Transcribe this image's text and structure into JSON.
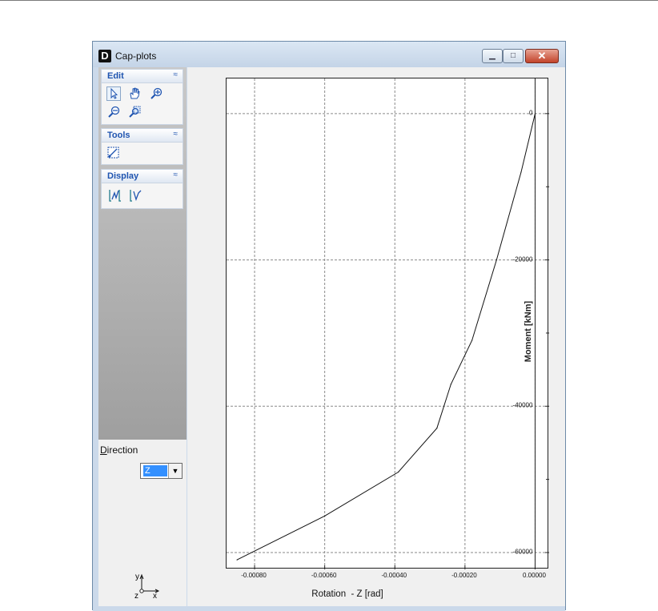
{
  "window": {
    "app_icon_letter": "D",
    "title": "Cap-plots",
    "minimize_glyph": "▁",
    "maximize_glyph": "□",
    "close_glyph": "✕"
  },
  "sidebar": {
    "groups": [
      {
        "title": "Edit",
        "collapse_glyph": "≈",
        "tools": [
          "select-arrow-icon",
          "hand-pan-icon",
          "zoom-in-icon",
          "zoom-out-icon",
          "zoom-window-icon"
        ]
      },
      {
        "title": "Tools",
        "collapse_glyph": "≈",
        "tools": [
          "measure-icon"
        ]
      },
      {
        "title": "Display",
        "collapse_glyph": "≈",
        "tools": [
          "display-curves-icon",
          "display-pointer-icon"
        ]
      }
    ],
    "direction": {
      "label_accel": "D",
      "label_rest": "irection",
      "selected": "Z",
      "arrow": "▼"
    },
    "triad": {
      "y": "y",
      "z": "z",
      "x": "x"
    }
  },
  "accent_color": "#1f54b0",
  "chart_data": {
    "type": "line",
    "title": "",
    "xlabel": "Rotation  - Z [rad]",
    "ylabel": "Moment [kNm]",
    "xlim": [
      -0.00088,
      4e-05
    ],
    "ylim": [
      -62300,
      4800
    ],
    "x_ticks": [
      -0.0008,
      -0.0006,
      -0.0004,
      -0.0002,
      0.0
    ],
    "x_tick_labels": [
      "-0.00080",
      "-0.00060",
      "-0.00040",
      "-0.00020",
      "0.00000"
    ],
    "y_ticks": [
      0,
      -20000,
      -40000,
      -60000
    ],
    "y_tick_labels": [
      "0",
      "-20000",
      "-40000",
      "-60000"
    ],
    "y_minor_ticks": [
      -10000,
      -30000,
      -50000
    ],
    "grid": true,
    "series": [
      {
        "x": [
          0.0,
          -4e-05,
          -0.00011,
          -0.00018,
          -0.00024,
          -0.00028,
          -0.00039,
          -0.0006,
          -0.00085
        ],
        "y": [
          0,
          -8000,
          -20000,
          -31000,
          -37000,
          -43000,
          -49000,
          -55000,
          -61000
        ]
      }
    ]
  }
}
